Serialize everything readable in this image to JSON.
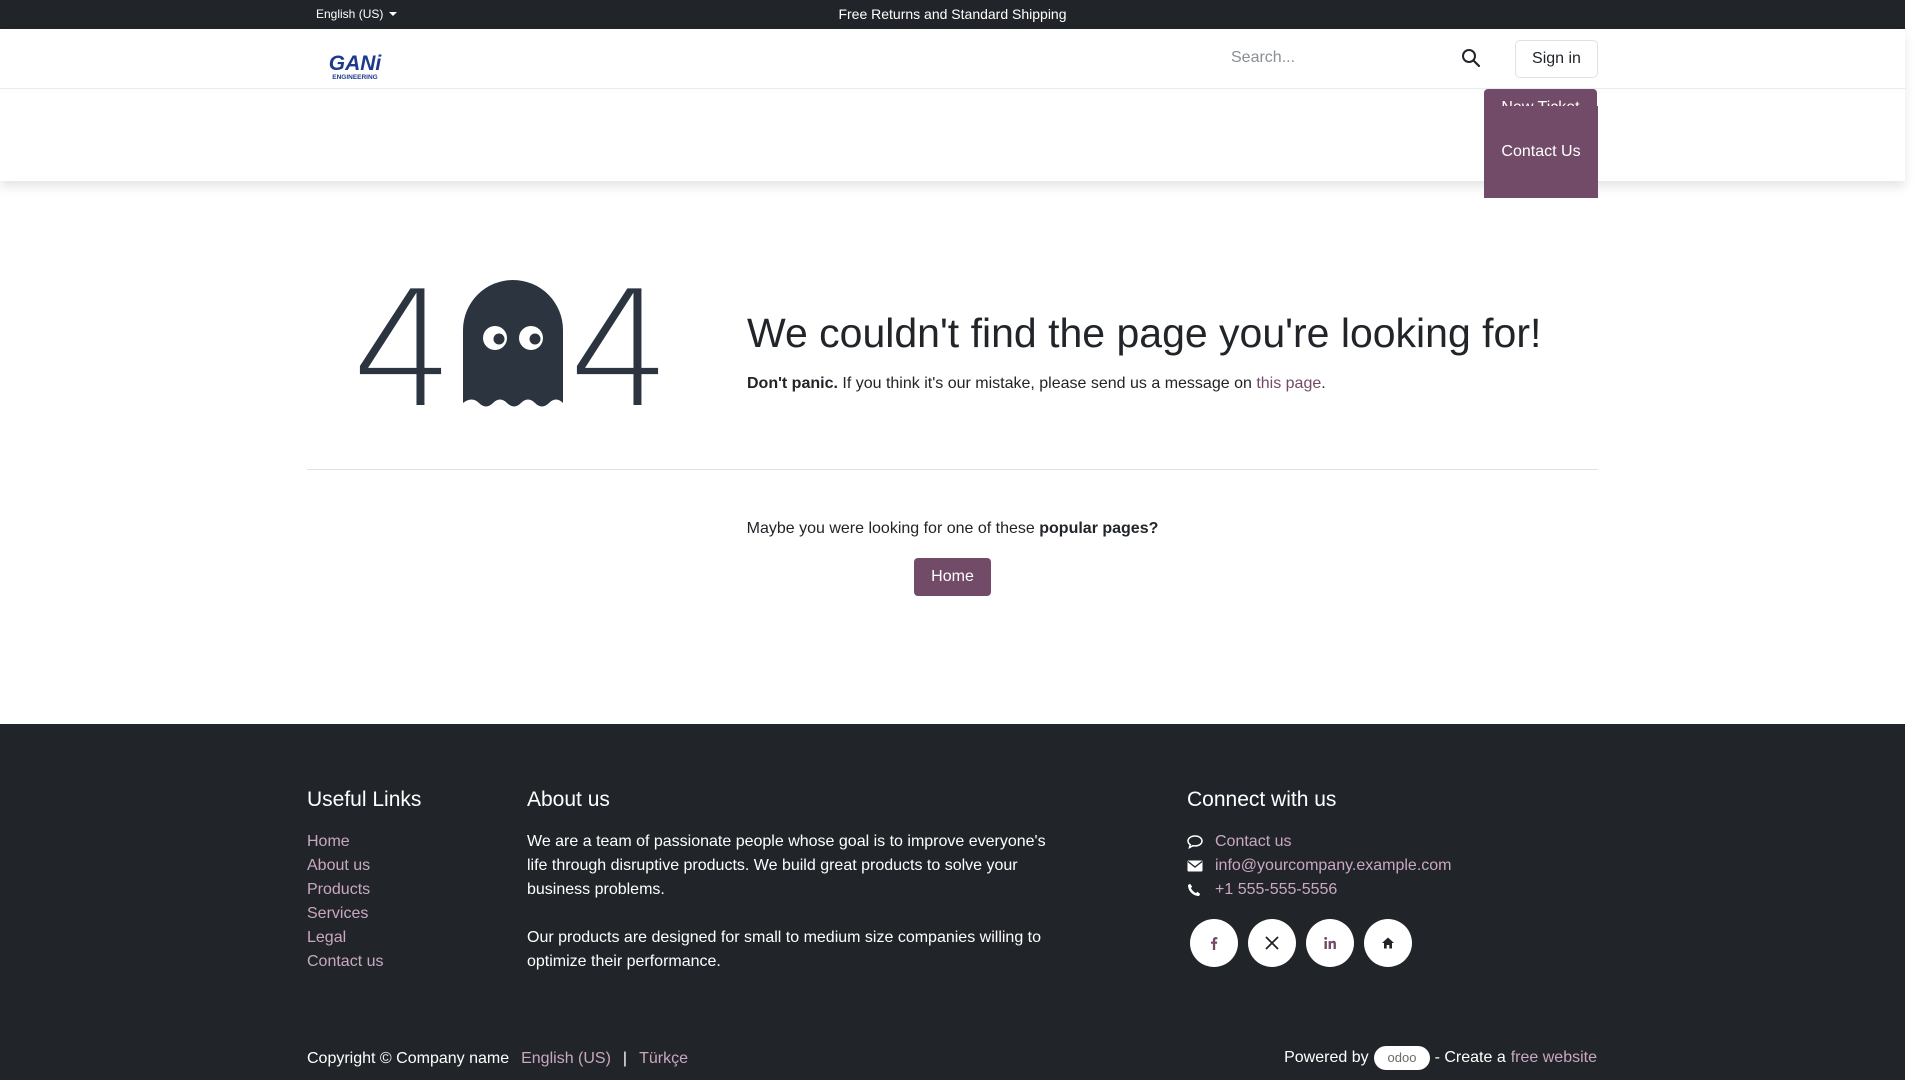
{
  "topbar": {
    "language": "English (US)",
    "promo": "Free Returns and Standard Shipping"
  },
  "header": {
    "logo_top": "GANi",
    "logo_bottom": "ENGINEERING",
    "search_placeholder": "Search...",
    "sign_in": "Sign in",
    "new_ticket": "New Ticket",
    "contact_us": "Contact Us"
  },
  "error": {
    "code_left": "4",
    "code_right": "4",
    "title": "We couldn't find the page you're looking for!",
    "lead_bold": "Don't panic.",
    "lead_text": " If you think it's our mistake, please send us a message on ",
    "lead_link": "this page",
    "lead_end": "."
  },
  "popular": {
    "text": "Maybe you were looking for one of these ",
    "bold": "popular pages?",
    "home": "Home"
  },
  "footer": {
    "useful_links_title": "Useful Links",
    "useful_links": [
      "Home",
      "About us",
      "Products",
      "Services",
      "Legal",
      "Contact us"
    ],
    "about_title": "About us",
    "about_p1": "We are a team of passionate people whose goal is to improve everyone's life through disruptive products. We build great products to solve your business problems.",
    "about_p2": "Our products are designed for small to medium size companies willing to optimize their performance.",
    "connect_title": "Connect with us",
    "contact_link": "Contact us",
    "email": "info@yourcompany.example.com",
    "phone": "+1 555-555-5556",
    "copyright": "Copyright © Company name",
    "lang_en": "English (US)",
    "lang_sep": "|",
    "lang_tr": "Türkçe",
    "powered_by": "Powered by",
    "odoo": "odoo",
    "create_a": "- Create a",
    "free_website": "free website"
  },
  "colors": {
    "brand": "#714b67",
    "dark": "#212529",
    "footer_link": "#c9a7c1"
  }
}
